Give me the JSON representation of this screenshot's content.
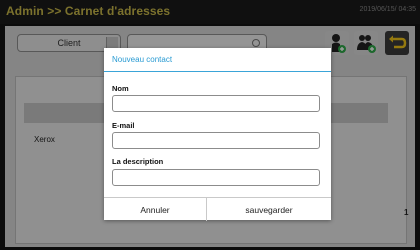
{
  "header": {
    "title": "Admin >> Carnet d'adresses",
    "datetime": "2019/06/15/ 04:35"
  },
  "toolbar": {
    "client_select_value": "Client",
    "search_value": "",
    "icons": {
      "add_person": "add-person-icon",
      "add_group": "add-group-icon",
      "back": "back-arrow-icon",
      "search": "search-icon"
    }
  },
  "list": {
    "rows": [
      {
        "name": "Xerox"
      }
    ],
    "count": "1"
  },
  "modal": {
    "title": "Nouveau contact",
    "fields": {
      "name_label": "Nom",
      "name_value": "",
      "email_label": "E-mail",
      "email_value": "",
      "description_label": "La description",
      "description_value": ""
    },
    "buttons": {
      "cancel": "Annuler",
      "save": "sauvegarder"
    }
  },
  "colors": {
    "title": "#c8b84a",
    "accent": "#2a9bd3",
    "panel": "#d7d7d7",
    "back_button": "#3a3a3a",
    "icon_green": "#2fa84a"
  }
}
